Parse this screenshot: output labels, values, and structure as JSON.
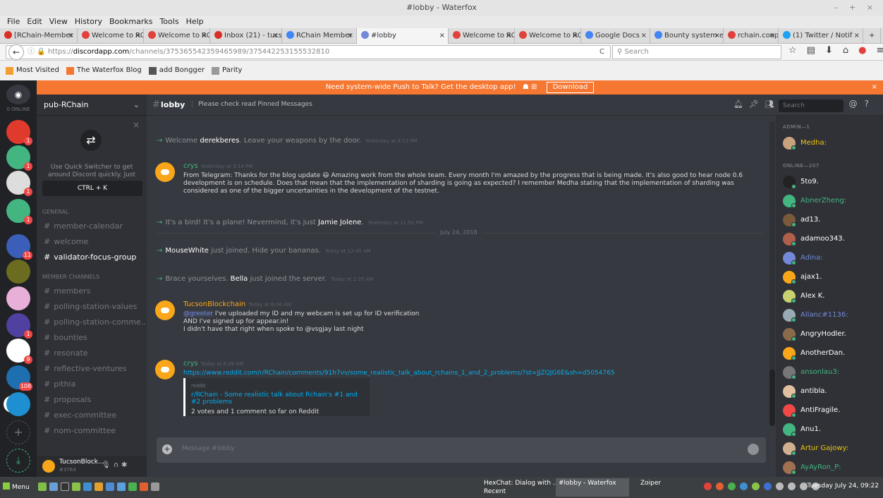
{
  "browser": {
    "window_title": "#lobby - Waterfox",
    "window_controls": "– + ×",
    "menu": [
      "File",
      "Edit",
      "View",
      "History",
      "Bookmarks",
      "Tools",
      "Help"
    ],
    "tabs": [
      {
        "label": "[RChain-Member",
        "icon_color": "#d93025"
      },
      {
        "label": "Welcome to RCh",
        "icon_color": "#e0413b"
      },
      {
        "label": "Welcome to RCh",
        "icon_color": "#e0413b"
      },
      {
        "label": "Inbox (21) - tucso",
        "icon_color": "#d93025"
      },
      {
        "label": "RChain Member",
        "icon_color": "#4285f4"
      },
      {
        "label": "#lobby",
        "icon_color": "#7289da",
        "active": true
      },
      {
        "label": "Welcome to RCh",
        "icon_color": "#e0413b"
      },
      {
        "label": "Welcome to RCh",
        "icon_color": "#e0413b"
      },
      {
        "label": "Google Docs",
        "icon_color": "#4285f4"
      },
      {
        "label": "Bounty system e",
        "icon_color": "#4285f4"
      },
      {
        "label": "rchain.coop",
        "icon_color": "#e0413b"
      },
      {
        "label": "(1) Twitter / Notif",
        "icon_color": "#1da1f2"
      }
    ],
    "tab_close": "×",
    "new_tab": "+",
    "url_prefix": "https://",
    "url_host": "discordapp.com",
    "url_path": "/channels/375365542359465989/375442253155532810",
    "reload_glyph": "C",
    "search_placeholder": "Search",
    "bookmarks": [
      {
        "label": "Most Visited",
        "color": "#f0a030"
      },
      {
        "label": "The Waterfox Blog",
        "color": "#f57731"
      },
      {
        "label": "add Bongger",
        "color": "#555"
      },
      {
        "label": "Parity",
        "color": "#999"
      }
    ]
  },
  "discord": {
    "notice": {
      "text": "Need system-wide Push to Talk? Get the desktop app!",
      "button": "Download",
      "close": "×"
    },
    "online_label": "0 ONLINE",
    "server_name": "pub-RChain",
    "quick_switcher": {
      "text": "Use Quick Switcher to get around Discord quickly. Just press:",
      "shortcut": "CTRL + K",
      "close": "×"
    },
    "categories": [
      {
        "name": "GENERAL",
        "channels": [
          {
            "name": "member-calendar",
            "icon": "#"
          },
          {
            "name": "welcome",
            "icon": "#"
          },
          {
            "name": "validator-focus-group",
            "icon": "#",
            "active": true
          }
        ]
      },
      {
        "name": "MEMBER CHANNELS",
        "channels": [
          {
            "name": "members",
            "icon": "#"
          },
          {
            "name": "polling-station-values",
            "icon": "#"
          },
          {
            "name": "polling-station-comme...",
            "icon": "#"
          },
          {
            "name": "bounties",
            "icon": "#"
          },
          {
            "name": "resonate",
            "icon": "#"
          },
          {
            "name": "reflective-ventures",
            "icon": "#"
          },
          {
            "name": "pithia",
            "icon": "#"
          },
          {
            "name": "proposals",
            "icon": "#"
          },
          {
            "name": "exec-committee",
            "icon": "#"
          },
          {
            "name": "nom-committee",
            "icon": "#"
          }
        ]
      }
    ],
    "user": {
      "name": "TucsonBlock...",
      "tag": "#3763"
    },
    "channel": {
      "name": "lobby",
      "topic": "Please check read Pinned Messages"
    },
    "header_search": "Search",
    "system_messages": [
      {
        "pre": "Welcome ",
        "name": "derekberes",
        "post": ". Leave your weapons by the door.",
        "ts": "Yesterday at 8:12 PM"
      },
      {
        "pre": "It's a bird! It's a plane! Nevermind, it's just ",
        "name": "Jamie Jolene",
        "post": ".",
        "ts": "Yesterday at 11:52 PM"
      },
      {
        "pre": "",
        "name": "MouseWhite",
        "post": " just joined. Hide your bananas.",
        "ts": "Today at 12:45 AM"
      },
      {
        "pre": "Brace yourselves. ",
        "name": "Bella",
        "post": " just joined the server.",
        "ts": "Today at 2:35 AM"
      }
    ],
    "date_divider": "July 24, 2018",
    "msg1": {
      "author": "crys",
      "author_color": "#43b581",
      "ts": "Yesterday at 9:19 PM",
      "body": "From Telegram: Thanks for the blog update 😃 Amazing work from the whole team. Every month I'm amazed by the progress that is being made. It's also  good to hear node 0.6 development is on schedule. Does that mean that the implementation of sharding is going as expected? I remember Medha stating that the implementation of sharding was considered as one of the bigger uncertainties in the development of the testnet."
    },
    "msg2": {
      "author": "TucsonBlockchain",
      "author_color": "#faa61a",
      "ts": "Today at 6:08 AM",
      "mention": "@greeter",
      "line1": " I've uploaded my ID and my webcam is set up for ID verification",
      "line2": "AND I've signed up for appear.in!",
      "line3": "I didn't have that right when spoke to @vsgjay last night"
    },
    "msg3": {
      "author": "crys",
      "author_color": "#43b581",
      "ts": "Today at 6:28 AM",
      "link": "https://www.reddit.com/r/RChain/comments/91h7vv/some_realistic_talk_about_rchains_1_and_2_problems/?st=JJZQJG6E&sh=d5054765",
      "embed_provider": "reddit",
      "embed_title": "r/RChain - Some realistic talk about Rchain's #1 and #2 problems",
      "embed_desc": "2 votes and 1 comment so far on Reddit"
    },
    "input_placeholder": "Message #lobby",
    "member_groups": [
      {
        "label": "ADMIN—1",
        "members": [
          {
            "name": "Medha:",
            "color": "#f1c40f",
            "av": "#c9a27e"
          }
        ]
      },
      {
        "label": "ONLINE—207",
        "members": [
          {
            "name": "5to9.",
            "color": "#ffffff",
            "av": "#222"
          },
          {
            "name": "AbnerZheng:",
            "color": "#43b581",
            "av": "#43b581"
          },
          {
            "name": "ad13.",
            "color": "#ffffff",
            "av": "#7a5a3a"
          },
          {
            "name": "adamoo343.",
            "color": "#ffffff",
            "av": "#b0604a"
          },
          {
            "name": "Adina:",
            "color": "#7289da",
            "av": "#7289da"
          },
          {
            "name": "ajax1.",
            "color": "#ffffff",
            "av": "#faa61a"
          },
          {
            "name": "Alex K.",
            "color": "#ffffff",
            "av": "#c8d070"
          },
          {
            "name": "Allanc#1136:",
            "color": "#7289da",
            "av": "#99aab5"
          },
          {
            "name": "AngryHodler.",
            "color": "#ffffff",
            "av": "#8a6a4a"
          },
          {
            "name": "AnotherDan.",
            "color": "#ffffff",
            "av": "#faa61a"
          },
          {
            "name": "ansonlau3:",
            "color": "#43b581",
            "av": "#777"
          },
          {
            "name": "antibla.",
            "color": "#ffffff",
            "av": "#e0c0a0"
          },
          {
            "name": "AntiFragile.",
            "color": "#ffffff",
            "av": "#f04747"
          },
          {
            "name": "Anu1.",
            "color": "#ffffff",
            "av": "#43b581"
          },
          {
            "name": "Artur Gajowy:",
            "color": "#f1c40f",
            "av": "#d0b090"
          },
          {
            "name": "AyAyRon_P:",
            "color": "#43b581",
            "av": "#a07050"
          }
        ]
      }
    ]
  },
  "taskbar": {
    "menu": "Menu",
    "windows": [
      {
        "line1": "HexChat: Dialog with ...",
        "line2": "Recent"
      },
      {
        "line1": "#lobby - Waterfox",
        "line2": ""
      },
      {
        "line1": "Zoiper",
        "line2": ""
      }
    ],
    "clock": "Tuesday July 24, 09:22"
  }
}
